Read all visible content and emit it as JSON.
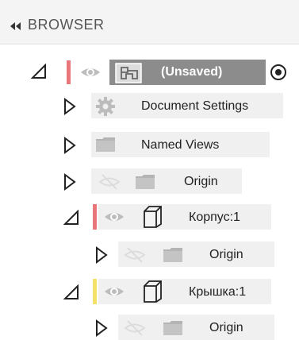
{
  "panel": {
    "title": "BROWSER",
    "collapse_icon": "double-chevron-left-icon"
  },
  "colors": {
    "header_bg": "#f4f4f4",
    "row_bg": "#f0f0f0",
    "root_row_bg": "#8c8c8c",
    "red_marker": "#e8767a",
    "yellow_marker": "#f3e26a"
  },
  "tree": {
    "root": {
      "label": "(Unsaved)",
      "state": "expanded"
    },
    "document_settings": {
      "label": "Document Settings",
      "state": "collapsed"
    },
    "named_views": {
      "label": "Named Views",
      "state": "collapsed"
    },
    "origin_root": {
      "label": "Origin",
      "state": "collapsed",
      "visibility": "hidden"
    },
    "component_1": {
      "label": "Корпус:1",
      "state": "expanded"
    },
    "origin_c1": {
      "label": "Origin",
      "state": "collapsed",
      "visibility": "hidden"
    },
    "component_2": {
      "label": "Крышка:1",
      "state": "expanded"
    },
    "origin_c2": {
      "label": "Origin",
      "state": "collapsed",
      "visibility": "hidden"
    }
  }
}
